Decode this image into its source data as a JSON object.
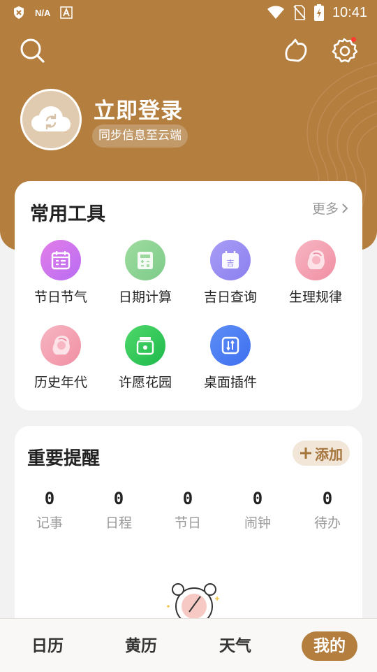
{
  "status_bar": {
    "network": "N/A",
    "time": "10:41"
  },
  "header": {
    "login_title": "立即登录",
    "sync_text": "同步信息至云端",
    "bg_color": "#b47e3e"
  },
  "tools": {
    "title": "常用工具",
    "more": "更多",
    "items": [
      {
        "label": "节日节气",
        "icon": "calendar-icon"
      },
      {
        "label": "日期计算",
        "icon": "calculator-icon"
      },
      {
        "label": "吉日查询",
        "icon": "lucky-calendar-icon"
      },
      {
        "label": "生理规律",
        "icon": "woman-icon"
      },
      {
        "label": "历史年代",
        "icon": "woman-icon"
      },
      {
        "label": "许愿花园",
        "icon": "wish-jar-icon"
      },
      {
        "label": "桌面插件",
        "icon": "widget-icon"
      }
    ]
  },
  "reminders": {
    "title": "重要提醒",
    "add_label": "添加",
    "stats": [
      {
        "count": "0",
        "label": "记事"
      },
      {
        "count": "0",
        "label": "日程"
      },
      {
        "count": "0",
        "label": "节日"
      },
      {
        "count": "0",
        "label": "闹钟"
      },
      {
        "count": "0",
        "label": "待办"
      }
    ]
  },
  "bottom_nav": {
    "tabs": [
      "日历",
      "黄历",
      "天气",
      "我的"
    ],
    "active": "我的"
  }
}
